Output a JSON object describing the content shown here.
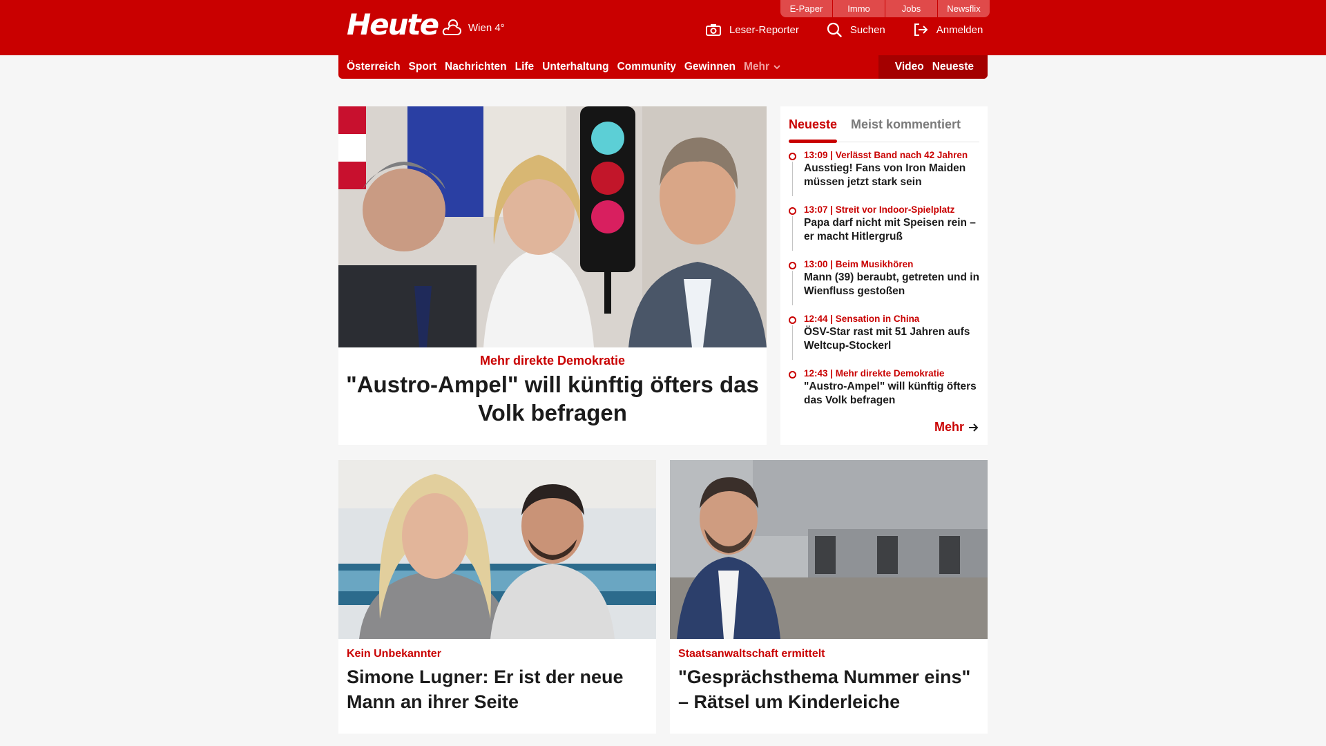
{
  "header": {
    "logo": "Heute",
    "weather": "Wien 4°",
    "top_links": [
      "E-Paper",
      "Immo",
      "Jobs",
      "Newsflix"
    ],
    "actions": [
      {
        "label": "Leser-Reporter",
        "icon": "camera-icon"
      },
      {
        "label": "Suchen",
        "icon": "search-icon"
      },
      {
        "label": "Anmelden",
        "icon": "login-icon"
      }
    ]
  },
  "nav": {
    "items": [
      "Österreich",
      "Sport",
      "Nachrichten",
      "Life",
      "Unterhaltung",
      "Community",
      "Gewinnen"
    ],
    "more": "Mehr",
    "right": [
      "Video",
      "Neueste"
    ]
  },
  "main_article": {
    "kicker": "Mehr direkte Demokratie",
    "headline": "\"Austro-Ampel\" will künftig öfters das Volk befragen"
  },
  "sidebar": {
    "tabs": [
      "Neueste",
      "Meist kommentiert"
    ],
    "items": [
      {
        "meta": "13:09 | Verlässt Band nach 42 Jahren",
        "title": "Ausstieg! Fans von Iron Maiden müssen jetzt stark sein"
      },
      {
        "meta": "13:07 | Streit vor Indoor-Spielplatz",
        "title": "Papa darf nicht mit Speisen rein – er macht Hitlergruß"
      },
      {
        "meta": "13:00 | Beim Musikhören",
        "title": "Mann (39) beraubt, getreten und in Wienfluss gestoßen"
      },
      {
        "meta": "12:44 | Sensation in China",
        "title": "ÖSV-Star rast mit 51 Jahren aufs Weltcup-Stockerl"
      },
      {
        "meta": "12:43 | Mehr direkte Demokratie",
        "title": "\"Austro-Ampel\" will künftig öfters das Volk befragen"
      }
    ],
    "more": "Mehr"
  },
  "cards": [
    {
      "kicker": "Kein Unbekannter",
      "headline": "Simone Lugner: Er ist der neue Mann an ihrer Seite"
    },
    {
      "kicker": "Staatsanwaltschaft ermittelt",
      "headline": "\"Gesprächsthema Nummer eins\" – Rätsel um Kinderleiche"
    }
  ],
  "colors": {
    "brand_red": "#c90000",
    "dark_red": "#a40000",
    "background": "#f6f6f6"
  }
}
